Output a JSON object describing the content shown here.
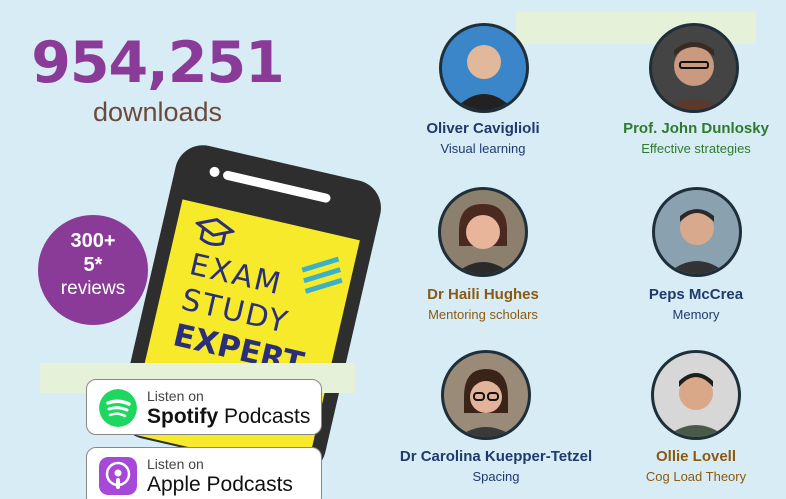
{
  "stats": {
    "downloads_count": "954,251",
    "downloads_label": "downloads"
  },
  "badge": {
    "line1": "300+",
    "line2": "5*",
    "line3": "reviews"
  },
  "cover": {
    "line1": "EXAM",
    "line2": "STUDY",
    "line3": "EXPERT"
  },
  "podcasts": {
    "spotify": {
      "prefix": "Listen on",
      "brand": "Spotify",
      "suffix": "Podcasts",
      "icon": "spotify-icon",
      "color": "#1ed760"
    },
    "apple": {
      "prefix": "Listen on",
      "brand": "Apple Podcasts",
      "icon": "apple-podcasts-icon",
      "color": "#a648d8"
    }
  },
  "experts": [
    {
      "name": "Oliver Caviglioli",
      "topic": "Visual learning"
    },
    {
      "name": "Prof. John Dunlosky",
      "topic": "Effective strategies"
    },
    {
      "name": "Dr Haili Hughes",
      "topic": "Mentoring scholars"
    },
    {
      "name": "Peps McCrea",
      "topic": "Memory"
    },
    {
      "name": "Dr Carolina Kuepper-Tetzel",
      "topic": "Spacing"
    },
    {
      "name": "Ollie Lovell",
      "topic": "Cog Load Theory"
    }
  ],
  "colors": {
    "background": "#d8ecf5",
    "purple": "#8a3a97",
    "highlight": "#e5f1d9",
    "navy": "#1f3a6b",
    "green": "#2e7a2e",
    "brown": "#8a5a12"
  }
}
